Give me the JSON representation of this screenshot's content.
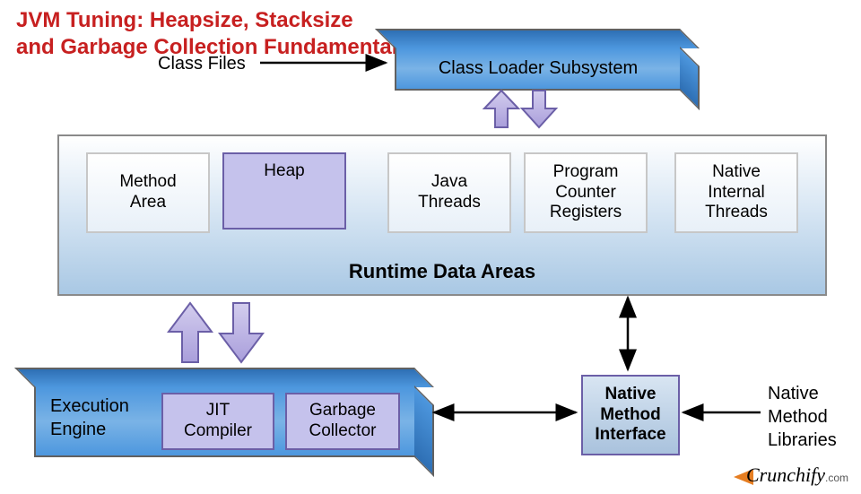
{
  "title_line1": "JVM Tuning: Heapsize, Stacksize",
  "title_line2": "and Garbage Collection Fundamental",
  "labels": {
    "class_files": "Class Files",
    "native_method_libraries": "Native\nMethod\nLibraries"
  },
  "boxes": {
    "class_loader": "Class Loader Subsystem",
    "execution_engine": "Execution\nEngine",
    "jit_compiler": "JIT\nCompiler",
    "garbage_collector": "Garbage\nCollector",
    "native_method_interface": "Native\nMethod\nInterface"
  },
  "runtime": {
    "title": "Runtime Data Areas",
    "areas": {
      "method_area": "Method\nArea",
      "heap": "Heap",
      "java_threads": "Java\nThreads",
      "pc_registers": "Program\nCounter\nRegisters",
      "native_threads": "Native\nInternal\nThreads"
    }
  },
  "watermark": {
    "brand": "Crunchify",
    "suffix": ".com"
  },
  "arrows": [
    "class-files-to-loader",
    "loader-to-runtime-up",
    "loader-to-runtime-down",
    "runtime-to-engine-up",
    "runtime-to-engine-down",
    "engine-to-nmi",
    "runtime-to-nmi",
    "libs-to-nmi"
  ]
}
